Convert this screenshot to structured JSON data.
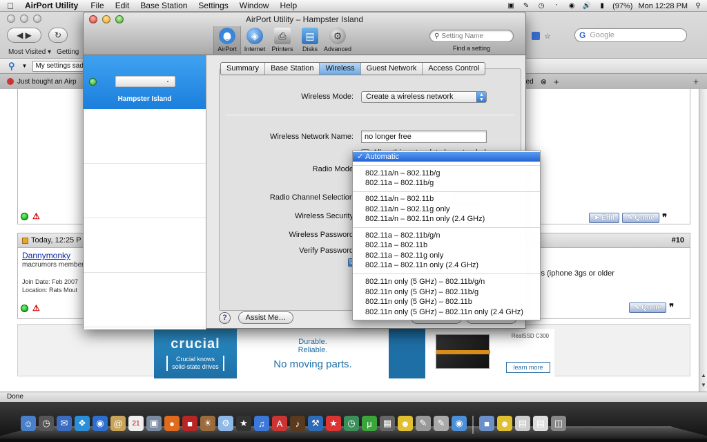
{
  "menubar": {
    "apple_icon": "apple-logo-icon",
    "app_name": "AirPort Utility",
    "items": [
      "File",
      "Edit",
      "Base Station",
      "Settings",
      "Window",
      "Help"
    ],
    "battery": "(97%)",
    "clock": "Mon 12:28 PM"
  },
  "browser": {
    "google_placeholder": "Google",
    "bookmarks": [
      "Most Visited ▾",
      "Getting"
    ],
    "toolbar_search_value": "My settings sad",
    "tab_left": "Just bought an Airp",
    "tab_right": "eed",
    "status": "Done",
    "post": {
      "date": "Today, 12:25 P",
      "number": "#10",
      "username": "Dannymonky",
      "rank": "macrumors member",
      "join": "Join Date: Feb 2007",
      "location": "Location: Rats Mout",
      "text": "vices (iphone 3gs or older"
    },
    "edit_label": "Edit",
    "quote_label": "Quote",
    "ad": {
      "brand": "crucial",
      "tagline_1": "Crucial knows",
      "tagline_2": "solid-state drives",
      "line_1": "Durable.",
      "line_2": "Reliable.",
      "line_3": "No moving parts.",
      "product": "RealSSD C300",
      "cta": "learn more"
    }
  },
  "window": {
    "title": "AirPort Utility – Hampster Island",
    "toolbar": [
      {
        "label": "AirPort",
        "icon": "airport-wifi-icon"
      },
      {
        "label": "Internet",
        "icon": "globe-icon"
      },
      {
        "label": "Printers",
        "icon": "printer-icon"
      },
      {
        "label": "Disks",
        "icon": "disk-icon"
      },
      {
        "label": "Advanced",
        "icon": "gear-icon"
      }
    ],
    "search_placeholder": "Setting Name",
    "search_label": "Find a setting",
    "sidebar": {
      "device_name": "Hampster Island"
    },
    "tabs": [
      "Summary",
      "Base Station",
      "Wireless",
      "Guest Network",
      "Access Control"
    ],
    "active_tab": "Wireless",
    "form": {
      "wireless_mode_label": "Wireless Mode:",
      "wireless_mode_value": "Create a wireless network",
      "network_name_label": "Wireless Network Name:",
      "network_name_value": "no longer free",
      "extend_label": "Allow this network to be extended",
      "radio_mode_label": "Radio Mode",
      "radio_channel_label": "Radio Channel Selection",
      "security_label": "Wireless Security",
      "password_label": "Wireless Password",
      "verify_label": "Verify Password"
    },
    "help_label": "?",
    "assist_label": "Assist Me…"
  },
  "radio_menu": {
    "selected": "Automatic",
    "check": "✓",
    "groups": [
      [
        "802.11a/n – 802.11b/g",
        "802.11a – 802.11b/g"
      ],
      [
        "802.11a/n – 802.11b",
        "802.11a/n – 802.11g only",
        "802.11a/n – 802.11n only (2.4 GHz)"
      ],
      [
        "802.11a – 802.11b/g/n",
        "802.11a – 802.11b",
        "802.11a – 802.11g only",
        "802.11a – 802.11n only (2.4 GHz)"
      ],
      [
        "802.11n only (5 GHz) – 802.11b/g/n",
        "802.11n only (5 GHz) – 802.11b/g",
        "802.11n only (5 GHz) – 802.11b",
        "802.11n only (5 GHz) – 802.11n only (2.4 GHz)"
      ]
    ]
  }
}
